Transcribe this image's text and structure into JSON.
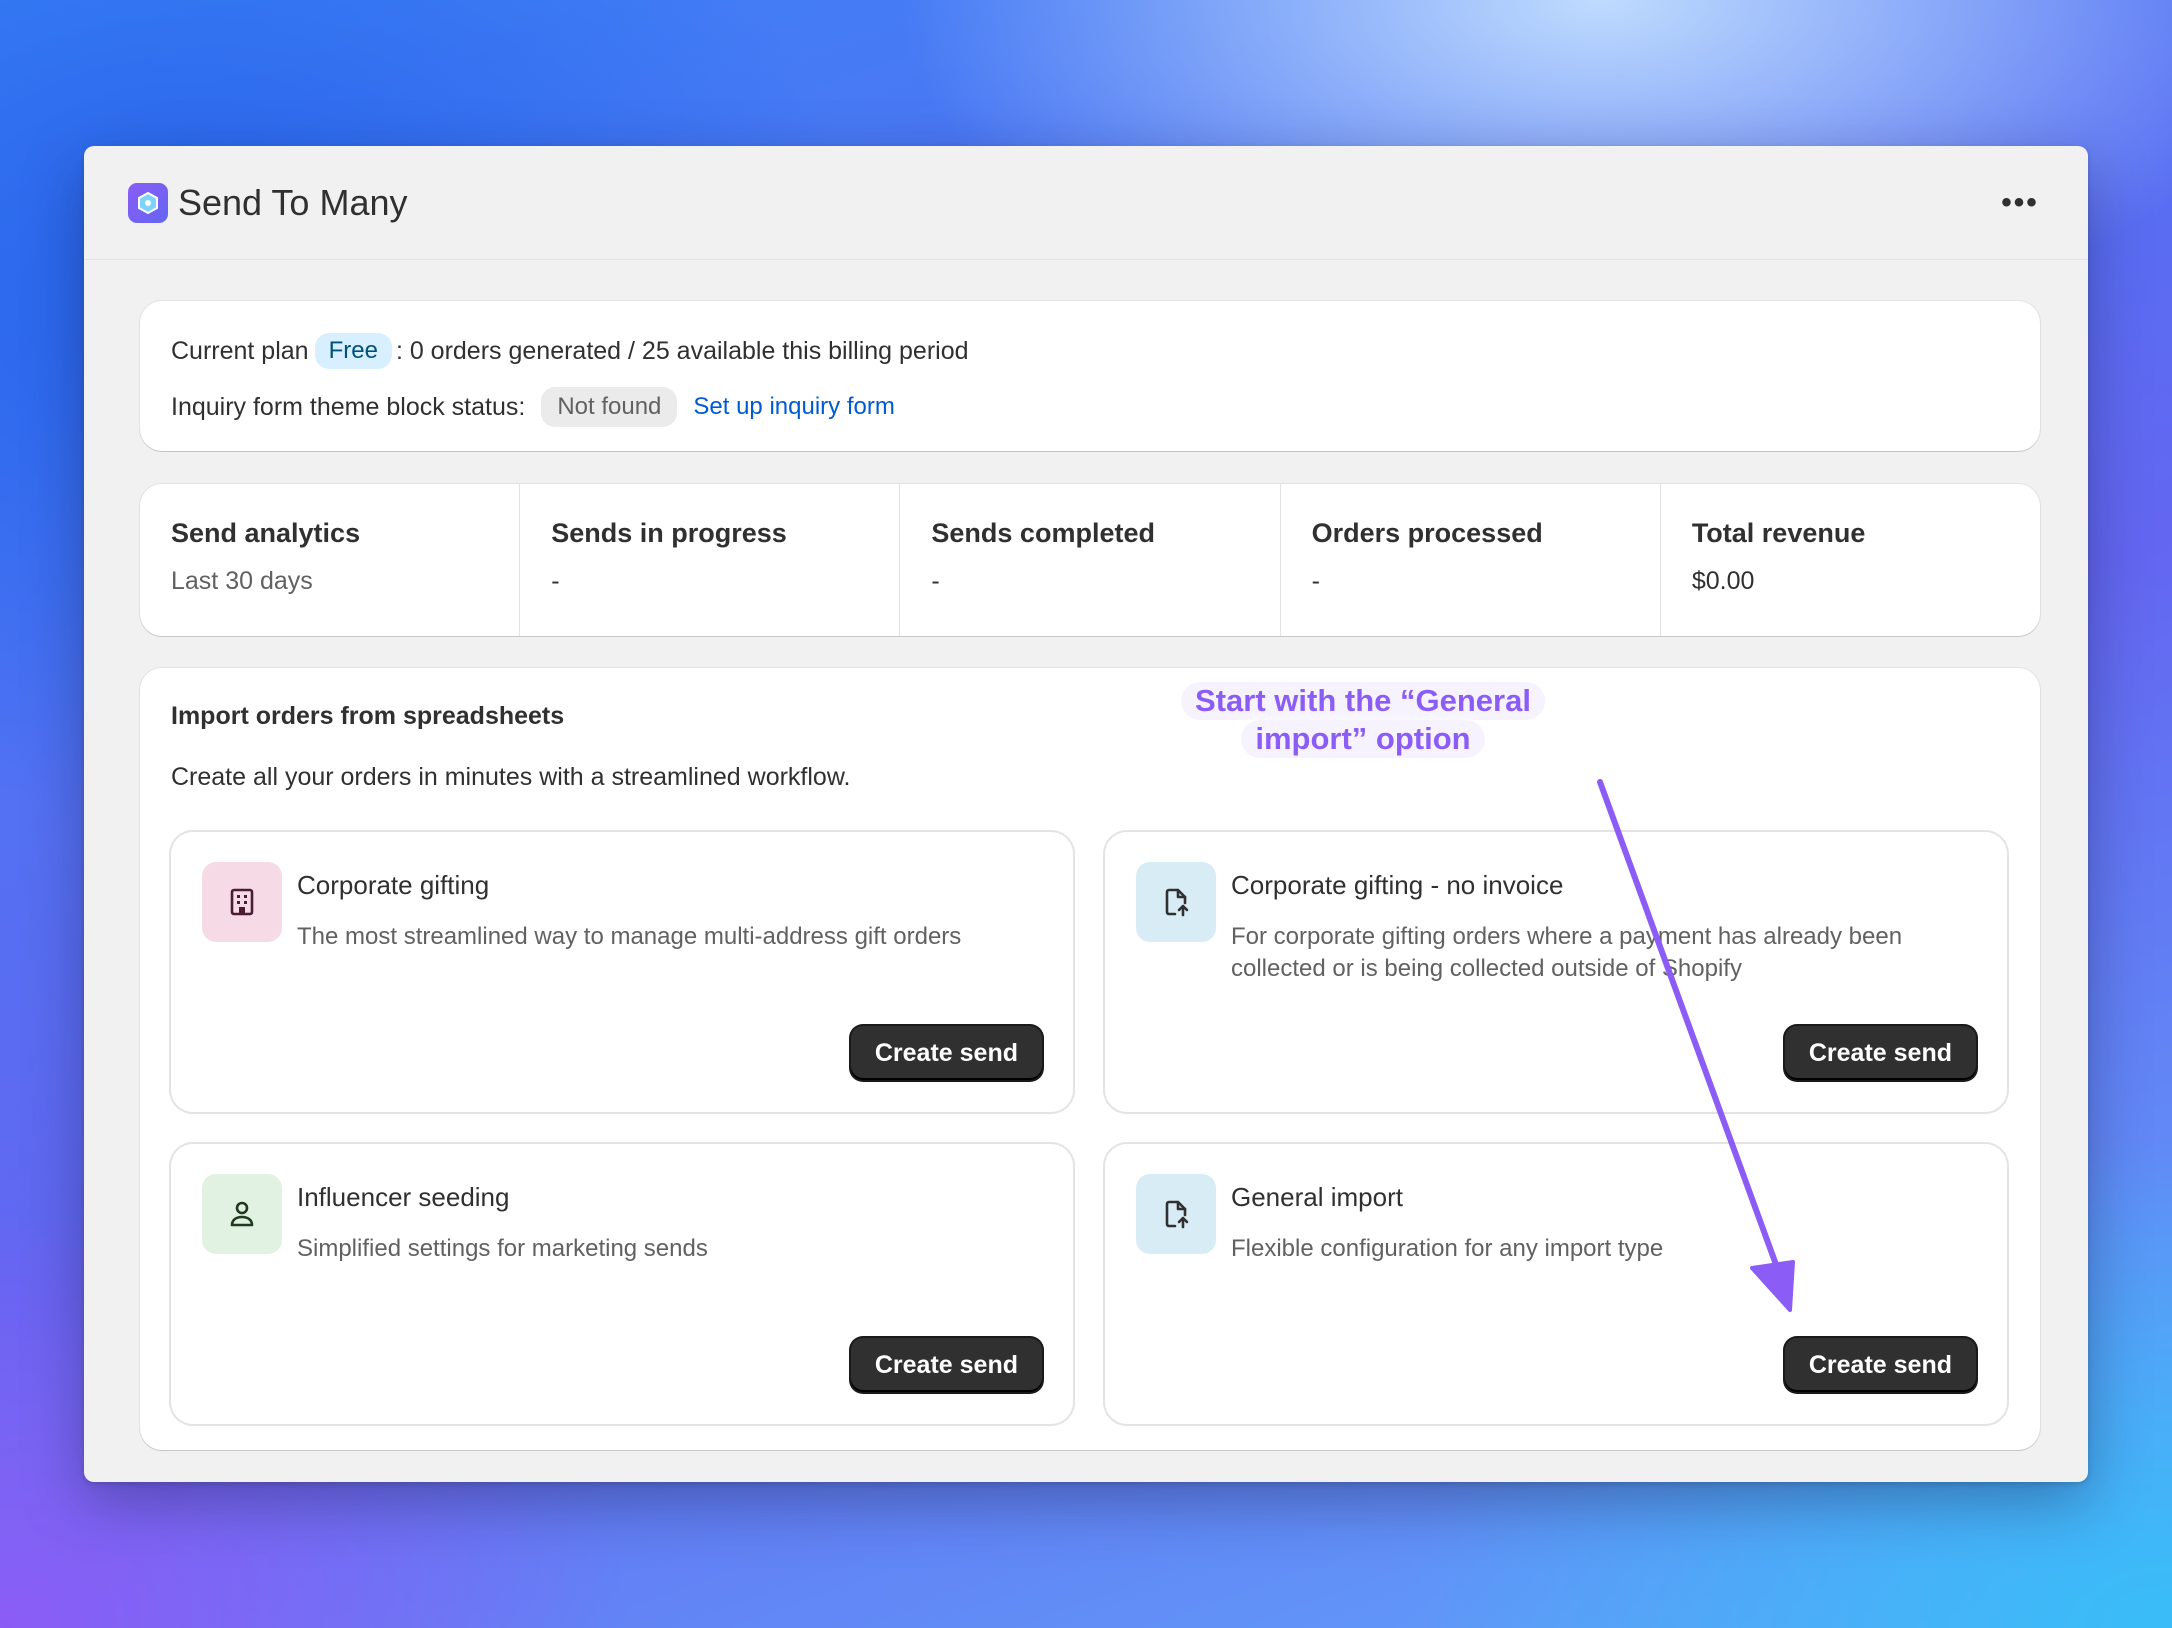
{
  "app": {
    "title": "Send To Many",
    "more_label": "•••"
  },
  "plan": {
    "current_plan_label": "Current plan",
    "plan_badge": "Free",
    "usage_text": ": 0 orders generated / 25 available this billing period",
    "inquiry_label": "Inquiry form theme block status:",
    "inquiry_status": "Not found",
    "inquiry_link": "Set up inquiry form"
  },
  "analytics": [
    {
      "title": "Send analytics",
      "value": "Last 30 days"
    },
    {
      "title": "Sends in progress",
      "value": "-"
    },
    {
      "title": "Sends completed",
      "value": "-"
    },
    {
      "title": "Orders processed",
      "value": "-"
    },
    {
      "title": "Total revenue",
      "value": "$0.00"
    }
  ],
  "import": {
    "title": "Import orders from spreadsheets",
    "description": "Create all your orders in minutes with a streamlined workflow.",
    "options": [
      {
        "title": "Corporate gifting",
        "description": "The most streamlined way to manage multi-address gift orders",
        "button": "Create send",
        "icon": "building-icon"
      },
      {
        "title": "Corporate gifting - no invoice",
        "description": "For corporate gifting orders where a payment has already been collected or is being collected outside of Shopify",
        "button": "Create send",
        "icon": "file-upload-icon"
      },
      {
        "title": "Influencer seeding",
        "description": "Simplified settings for marketing sends",
        "button": "Create send",
        "icon": "person-icon"
      },
      {
        "title": "General import",
        "description": "Flexible configuration for any import type",
        "button": "Create send",
        "icon": "file-upload-icon"
      }
    ]
  },
  "annotation": {
    "line1": "Start with the “General",
    "line2": "import” option"
  },
  "colors": {
    "accent_purple": "#8b5cf6",
    "link_blue": "#005bd3",
    "button_dark": "#303030",
    "badge_blue_bg": "#d8efff",
    "icon_pink_bg": "#f6dbe6",
    "icon_blue_bg": "#d8ecf6",
    "icon_green_bg": "#e2f2e2"
  }
}
